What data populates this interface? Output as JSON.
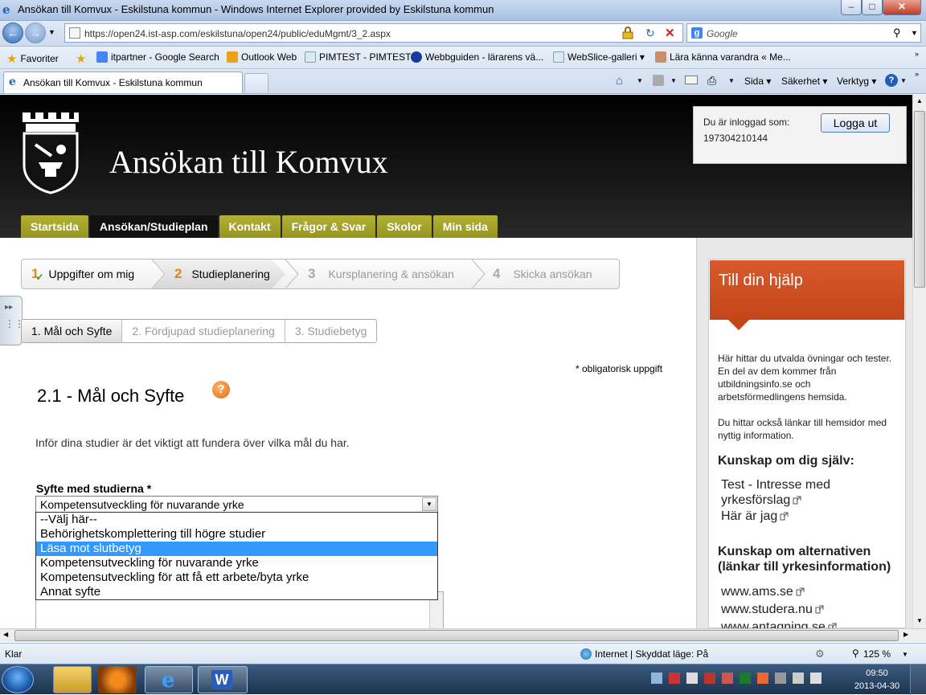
{
  "window": {
    "title": "Ansökan till Komvux - Eskilstuna kommun - Windows Internet Explorer provided by Eskilstuna kommun",
    "min": "–",
    "max": "□",
    "close": "✕"
  },
  "address": {
    "url": "https://open24.ist-asp.com/eskilstuna/open24/public/eduMgmt/3_2.aspx",
    "search_placeholder": "Google"
  },
  "favorites": {
    "label": "Favoriter",
    "items": [
      "itpartner - Google Search",
      "Outlook Web",
      "PIMTEST - PIMTEST",
      "Webbguiden - lärarens vä...",
      "WebSlice-galleri ▾",
      "Lära känna varandra « Me..."
    ]
  },
  "tabs": {
    "active": "Ansökan till Komvux - Eskilstuna kommun"
  },
  "commandbar": {
    "sida": "Sida ▾",
    "sakerhet": "Säkerhet ▾",
    "verktyg": "Verktyg ▾"
  },
  "header": {
    "site_title": "Ansökan till Komvux",
    "login_label": "Du är inloggad som:",
    "login_user": "197304210144",
    "logout": "Logga ut"
  },
  "mainnav": [
    "Startsida",
    "Ansökan/Studieplan",
    "Kontakt",
    "Frågor & Svar",
    "Skolor",
    "Min sida"
  ],
  "steps": [
    {
      "num": "1",
      "label": "Uppgifter om mig"
    },
    {
      "num": "2",
      "label": "Studieplanering"
    },
    {
      "num": "3",
      "label": "Kursplanering & ansökan"
    },
    {
      "num": "4",
      "label": "Skicka ansökan"
    }
  ],
  "subtabs": [
    "1. Mål och Syfte",
    "2. Fördjupad studieplanering",
    "3. Studiebetyg"
  ],
  "form": {
    "obligatory": "* obligatorisk uppgift",
    "heading": "2.1 - Mål och Syfte",
    "help_icon": "?",
    "intro": "Inför dina studier är det viktigt att fundera över vilka mål du har.",
    "syfte_label": "Syfte med studierna *",
    "selected": "Kompetensutveckling för nuvarande yrke",
    "options": [
      "--Välj här--",
      "Behörighetskomplettering till högre studier",
      "Läsa mot slutbetyg",
      "Kompetensutveckling för nuvarande yrke",
      "Kompetensutveckling för att få ett arbete/byta yrke",
      "Annat syfte"
    ],
    "highlighted_index": 2
  },
  "sidebar": {
    "title": "Till din hjälp",
    "p1": "Här hittar du utvalda övningar och tester. En del av dem kommer från utbildningsinfo.se och arbetsförmedlingens hemsida.",
    "p2": "Du hittar också länkar till hemsidor med nyttig information.",
    "h1": "Kunskap om dig själv:",
    "links1": [
      "Test - Intresse med",
      "yrkesförslag",
      "Här är jag"
    ],
    "h2": "Kunskap om alternativen (länkar till yrkesinformation)",
    "links2": [
      "www.ams.se",
      "www.studera.nu",
      "www.antagning.se"
    ]
  },
  "status": {
    "left": "Klar",
    "zone": "Internet | Skyddat läge: På",
    "zoom": "125 %"
  },
  "clock": {
    "time": "09:50",
    "date": "2013-04-30"
  },
  "colors": {
    "nav_olive": "#a3a22a",
    "help_orange": "#cf5020",
    "select_blue": "#3399ff"
  }
}
